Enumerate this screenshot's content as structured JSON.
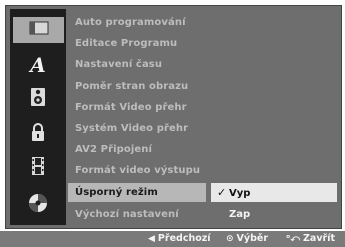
{
  "icons": [
    {
      "name": "disc-icon",
      "label": ""
    },
    {
      "name": "language-icon",
      "label": "A"
    },
    {
      "name": "speaker-icon",
      "label": ""
    },
    {
      "name": "lock-icon",
      "label": ""
    },
    {
      "name": "film-icon",
      "label": ""
    },
    {
      "name": "dvd-disc-icon",
      "label": ""
    }
  ],
  "menu": {
    "items": [
      {
        "label": "Auto programování"
      },
      {
        "label": "Editace Programu"
      },
      {
        "label": "Nastavení času"
      },
      {
        "label": "Poměr stran obrazu"
      },
      {
        "label": "Formát Video přehr"
      },
      {
        "label": "Systém Video přehr"
      },
      {
        "label": "AV2 Připojení"
      },
      {
        "label": "Formát video výstupu"
      },
      {
        "label": "Úsporný režim"
      },
      {
        "label": "Výchozí nastavení"
      }
    ],
    "selected_index": 8
  },
  "options": {
    "items": [
      {
        "label": "Vyp",
        "checked": true
      },
      {
        "label": "Zap",
        "checked": false
      }
    ],
    "check_glyph": "✓"
  },
  "hints": {
    "prev_glyph": "◀",
    "prev_label": "Předchozí",
    "select_glyph": "⊙",
    "select_label": "Výběr",
    "close_glyph": "ᵒ⤺",
    "close_label": "Zavřít"
  },
  "colors": {
    "panel_bg": "#6e6e6e",
    "icon_strip_bg": "#1e1e1e",
    "selected_row_bg": "#b7b7b7",
    "selected_option_bg": "#e8e8e8",
    "menu_text": "#bdbdbd"
  }
}
